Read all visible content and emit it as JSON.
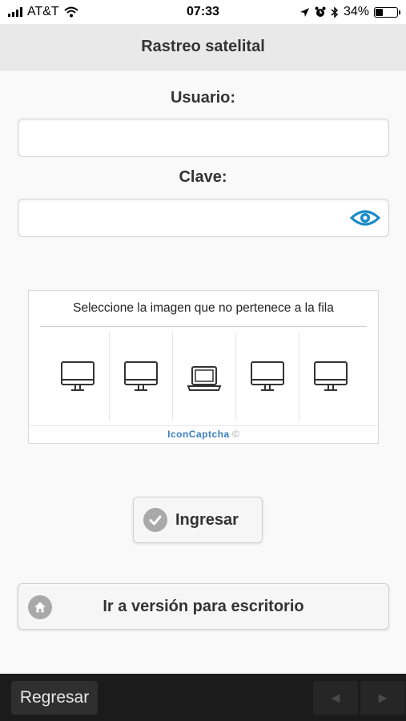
{
  "status_bar": {
    "carrier": "AT&T",
    "time": "07:33",
    "battery_percent": "34%",
    "battery_level": 0.34,
    "icons": [
      "signal-icon",
      "wifi-icon",
      "location-icon",
      "alarm-icon",
      "bluetooth-icon",
      "battery-icon"
    ]
  },
  "header": {
    "title": "Rastreo satelital"
  },
  "form": {
    "user_label": "Usuario:",
    "user_value": "",
    "password_label": "Clave:",
    "password_value": "",
    "show_password_icon": "eye-icon"
  },
  "captcha": {
    "instruction": "Seleccione la imagen que no pertenece a la fila",
    "items": [
      "monitor-icon",
      "monitor-icon",
      "laptop-icon",
      "monitor-icon",
      "monitor-icon"
    ],
    "brand": "IconCaptcha",
    "copyright": "©"
  },
  "buttons": {
    "login_label": "Ingresar",
    "desktop_label": "Ir a versión para escritorio"
  },
  "footer": {
    "back_label": "Regresar",
    "prev_label": "◄",
    "next_label": "►"
  },
  "colors": {
    "accent": "#1a8ac6",
    "header_bg": "#e9e9e9",
    "footer_bg": "#1b1b1b",
    "captcha_brand": "#3a7fc1"
  }
}
